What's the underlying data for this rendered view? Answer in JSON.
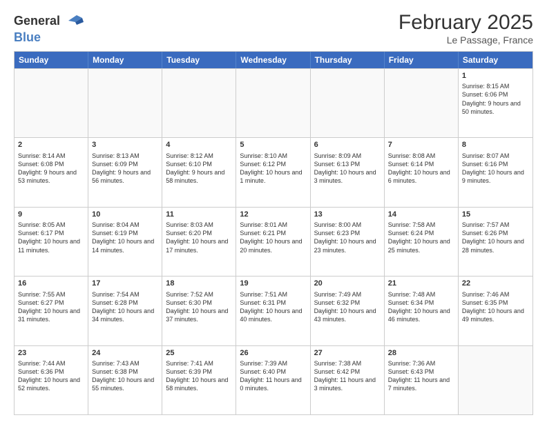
{
  "header": {
    "logo_general": "General",
    "logo_blue": "Blue",
    "title": "February 2025",
    "subtitle": "Le Passage, France"
  },
  "days_of_week": [
    "Sunday",
    "Monday",
    "Tuesday",
    "Wednesday",
    "Thursday",
    "Friday",
    "Saturday"
  ],
  "weeks": [
    [
      {
        "day": "",
        "text": ""
      },
      {
        "day": "",
        "text": ""
      },
      {
        "day": "",
        "text": ""
      },
      {
        "day": "",
        "text": ""
      },
      {
        "day": "",
        "text": ""
      },
      {
        "day": "",
        "text": ""
      },
      {
        "day": "1",
        "text": "Sunrise: 8:15 AM\nSunset: 6:06 PM\nDaylight: 9 hours and 50 minutes."
      }
    ],
    [
      {
        "day": "2",
        "text": "Sunrise: 8:14 AM\nSunset: 6:08 PM\nDaylight: 9 hours and 53 minutes."
      },
      {
        "day": "3",
        "text": "Sunrise: 8:13 AM\nSunset: 6:09 PM\nDaylight: 9 hours and 56 minutes."
      },
      {
        "day": "4",
        "text": "Sunrise: 8:12 AM\nSunset: 6:10 PM\nDaylight: 9 hours and 58 minutes."
      },
      {
        "day": "5",
        "text": "Sunrise: 8:10 AM\nSunset: 6:12 PM\nDaylight: 10 hours and 1 minute."
      },
      {
        "day": "6",
        "text": "Sunrise: 8:09 AM\nSunset: 6:13 PM\nDaylight: 10 hours and 3 minutes."
      },
      {
        "day": "7",
        "text": "Sunrise: 8:08 AM\nSunset: 6:14 PM\nDaylight: 10 hours and 6 minutes."
      },
      {
        "day": "8",
        "text": "Sunrise: 8:07 AM\nSunset: 6:16 PM\nDaylight: 10 hours and 9 minutes."
      }
    ],
    [
      {
        "day": "9",
        "text": "Sunrise: 8:05 AM\nSunset: 6:17 PM\nDaylight: 10 hours and 11 minutes."
      },
      {
        "day": "10",
        "text": "Sunrise: 8:04 AM\nSunset: 6:19 PM\nDaylight: 10 hours and 14 minutes."
      },
      {
        "day": "11",
        "text": "Sunrise: 8:03 AM\nSunset: 6:20 PM\nDaylight: 10 hours and 17 minutes."
      },
      {
        "day": "12",
        "text": "Sunrise: 8:01 AM\nSunset: 6:21 PM\nDaylight: 10 hours and 20 minutes."
      },
      {
        "day": "13",
        "text": "Sunrise: 8:00 AM\nSunset: 6:23 PM\nDaylight: 10 hours and 23 minutes."
      },
      {
        "day": "14",
        "text": "Sunrise: 7:58 AM\nSunset: 6:24 PM\nDaylight: 10 hours and 25 minutes."
      },
      {
        "day": "15",
        "text": "Sunrise: 7:57 AM\nSunset: 6:26 PM\nDaylight: 10 hours and 28 minutes."
      }
    ],
    [
      {
        "day": "16",
        "text": "Sunrise: 7:55 AM\nSunset: 6:27 PM\nDaylight: 10 hours and 31 minutes."
      },
      {
        "day": "17",
        "text": "Sunrise: 7:54 AM\nSunset: 6:28 PM\nDaylight: 10 hours and 34 minutes."
      },
      {
        "day": "18",
        "text": "Sunrise: 7:52 AM\nSunset: 6:30 PM\nDaylight: 10 hours and 37 minutes."
      },
      {
        "day": "19",
        "text": "Sunrise: 7:51 AM\nSunset: 6:31 PM\nDaylight: 10 hours and 40 minutes."
      },
      {
        "day": "20",
        "text": "Sunrise: 7:49 AM\nSunset: 6:32 PM\nDaylight: 10 hours and 43 minutes."
      },
      {
        "day": "21",
        "text": "Sunrise: 7:48 AM\nSunset: 6:34 PM\nDaylight: 10 hours and 46 minutes."
      },
      {
        "day": "22",
        "text": "Sunrise: 7:46 AM\nSunset: 6:35 PM\nDaylight: 10 hours and 49 minutes."
      }
    ],
    [
      {
        "day": "23",
        "text": "Sunrise: 7:44 AM\nSunset: 6:36 PM\nDaylight: 10 hours and 52 minutes."
      },
      {
        "day": "24",
        "text": "Sunrise: 7:43 AM\nSunset: 6:38 PM\nDaylight: 10 hours and 55 minutes."
      },
      {
        "day": "25",
        "text": "Sunrise: 7:41 AM\nSunset: 6:39 PM\nDaylight: 10 hours and 58 minutes."
      },
      {
        "day": "26",
        "text": "Sunrise: 7:39 AM\nSunset: 6:40 PM\nDaylight: 11 hours and 0 minutes."
      },
      {
        "day": "27",
        "text": "Sunrise: 7:38 AM\nSunset: 6:42 PM\nDaylight: 11 hours and 3 minutes."
      },
      {
        "day": "28",
        "text": "Sunrise: 7:36 AM\nSunset: 6:43 PM\nDaylight: 11 hours and 7 minutes."
      },
      {
        "day": "",
        "text": ""
      }
    ]
  ]
}
